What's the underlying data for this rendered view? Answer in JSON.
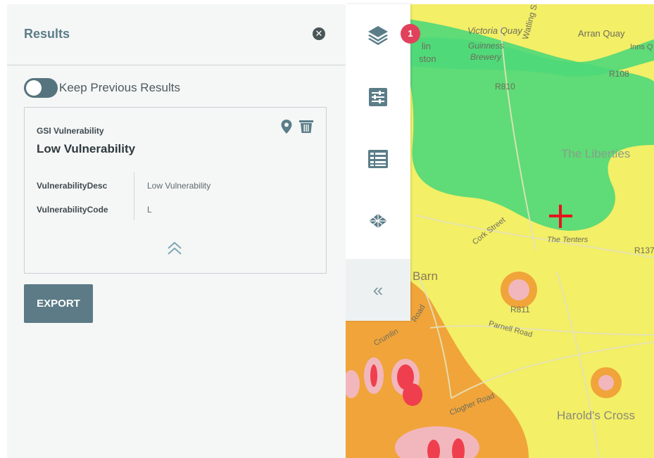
{
  "results_panel": {
    "title": "Results",
    "close_icon": "close-circle-icon",
    "keep_previous_label": "Keep Previous Results",
    "keep_previous_on": true,
    "card": {
      "layer_name": "GSI Vulnerability",
      "feature_title": "Low Vulnerability",
      "attributes": [
        {
          "key": "VulnerabilityDesc",
          "value": "Low Vulnerability"
        },
        {
          "key": "VulnerabilityCode",
          "value": "L"
        }
      ],
      "icons": [
        "map-pin-icon",
        "trash-icon",
        "collapse-up-icon"
      ]
    },
    "export_label": "EXPORT"
  },
  "toolbar": {
    "items": [
      {
        "icon": "layers-icon",
        "badge": "1"
      },
      {
        "icon": "sliders-icon"
      },
      {
        "icon": "table-list-icon"
      },
      {
        "icon": "basemap-icon"
      }
    ],
    "collapse_label": "«"
  },
  "map": {
    "labels": {
      "victoria_quay": "Victoria Quay",
      "arran_quay": "Arran Quay",
      "inns": "Inns Q",
      "guinness": "Guinness",
      "brewery": "Brewery",
      "watling": "Watling Street",
      "lin": "lin",
      "ston": "ston",
      "r108": "R108",
      "r810": "R810",
      "liberties": "The Liberties",
      "cork_street": "Cork Street",
      "tenters": "The Tenters",
      "r137": "R137",
      "barn": "Barn",
      "r811": "R811",
      "parnell": "Parnell Road",
      "crumlin": "Crumlin",
      "road": "Road",
      "clogher": "Clogher Road",
      "harolds": "Harold's Cross"
    },
    "colors": {
      "low": "#4fd879",
      "moderate": "#f3ef66",
      "high": "#f0a43a",
      "extreme": "#ef3f4f"
    },
    "marker_icon": "red-cross-icon"
  }
}
